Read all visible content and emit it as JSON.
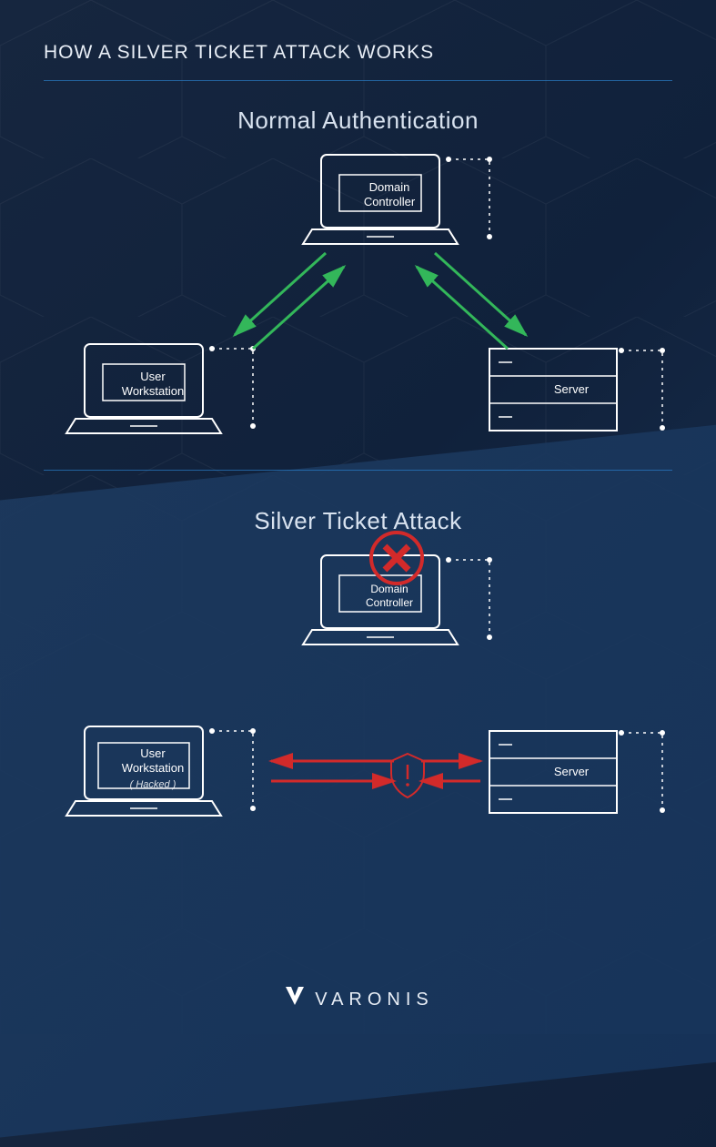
{
  "title": "HOW A SILVER TICKET ATTACK WORKS",
  "sections": {
    "normal": {
      "heading": "Normal Authentication",
      "nodes": {
        "dc": {
          "label_line1": "Domain",
          "label_line2": "Controller"
        },
        "workstation": {
          "label_line1": "User",
          "label_line2": "Workstation"
        },
        "server": {
          "label": "Server"
        }
      }
    },
    "attack": {
      "heading": "Silver Ticket Attack",
      "nodes": {
        "dc": {
          "label_line1": "Domain",
          "label_line2": "Controller"
        },
        "workstation": {
          "label_line1": "User",
          "label_line2": "Workstation",
          "sublabel": "( Hacked )"
        },
        "server": {
          "label": "Server"
        }
      }
    }
  },
  "brand": "VARONIS",
  "colors": {
    "accent_blue": "#2a7ec7",
    "arrow_green": "#33b75a",
    "arrow_red": "#d22a2a",
    "stroke": "#ffffff"
  }
}
